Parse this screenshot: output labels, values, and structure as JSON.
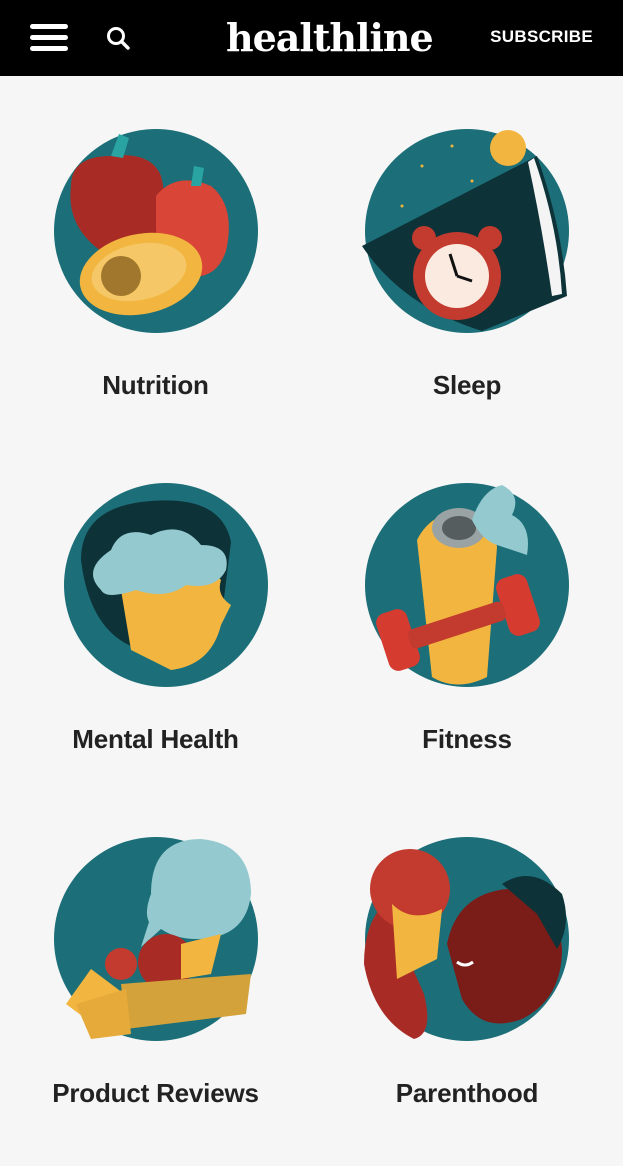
{
  "header": {
    "logo": "healthline",
    "subscribe_label": "SUBSCRIBE",
    "menu_icon": "hamburger-menu-icon",
    "search_icon": "search-icon"
  },
  "colors": {
    "header_bg": "#000000",
    "page_bg": "#f6f6f6",
    "teal": "#1c6f78",
    "red": "#c23b2e",
    "yellow": "#f2b640",
    "dark": "#0d3238"
  },
  "categories": [
    {
      "label": "Nutrition",
      "icon": "nutrition-illustration-icon"
    },
    {
      "label": "Sleep",
      "icon": "sleep-illustration-icon"
    },
    {
      "label": "Mental Health",
      "icon": "mental-health-illustration-icon"
    },
    {
      "label": "Fitness",
      "icon": "fitness-illustration-icon"
    },
    {
      "label": "Product Reviews",
      "icon": "product-reviews-illustration-icon"
    },
    {
      "label": "Parenthood",
      "icon": "parenthood-illustration-icon"
    }
  ]
}
